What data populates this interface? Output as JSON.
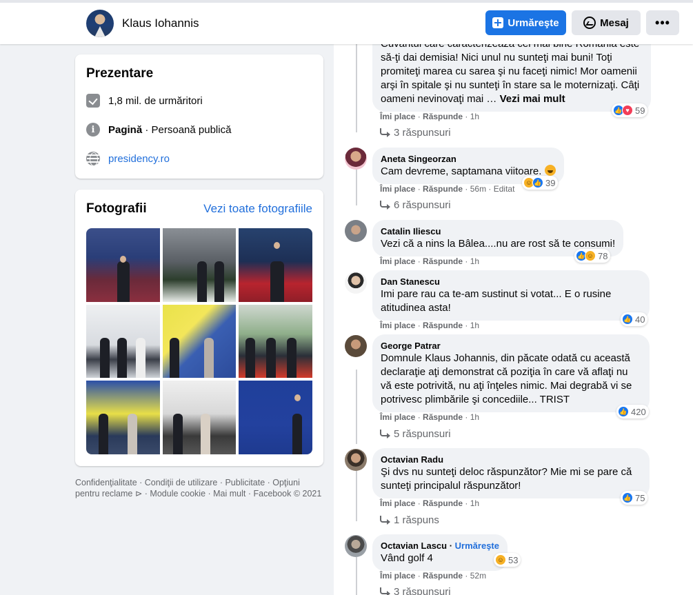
{
  "header": {
    "name": "Klaus Iohannis",
    "follow_label": "Urmăreşte",
    "message_label": "Mesaj",
    "more_label": "•••"
  },
  "intro": {
    "title": "Prezentare",
    "followers": "1,8 mil. de urmăritori",
    "page_type_bold": "Pagină",
    "page_type_rest": " · Persoană publică",
    "website": "presidency.ro"
  },
  "photos": {
    "title": "Fotografii",
    "see_all": "Vezi toate fotografiile"
  },
  "footer": {
    "text": "Confidenţialitate · Condiţii de utilizare · Publicitate · Opţiuni pentru reclame ⊳ · Module cookie · Mai mult · Facebook © 2021"
  },
  "comments": [
    {
      "text": "Cuvântul care caracterizează cel mai bine România este să-ţi dai demisia! Nici unul nu sunteţi mai buni! Toţi promiteţi marea cu sarea şi nu faceţi nimic! Mor oamenii arşi în spitale şi nu sunteţi în stare sa le moternizaţi. Câţi oameni nevinovaţi mai …",
      "see_more": "Vezi mai mult",
      "like": "Îmi place",
      "reply": "Răspunde",
      "time": "1h",
      "reactions": "59",
      "replies": "3 răspunsuri"
    },
    {
      "author": "Aneta Singeorzan",
      "text": "Cam devreme, saptamana viitoare.",
      "like": "Îmi place",
      "reply": "Răspunde",
      "time": "56m",
      "edited": "Editat",
      "reactions": "39",
      "replies": "6 răspunsuri"
    },
    {
      "author": "Catalin Iliescu",
      "text": "Vezi că a nins la Bâlea....nu are rost să te consumi!",
      "like": "Îmi place",
      "reply": "Răspunde",
      "time": "1h",
      "reactions": "78"
    },
    {
      "author": "Dan Stanescu",
      "text": "Imi pare rau ca te-am sustinut si votat... E o rusine atitudinea asta!",
      "like": "Îmi place",
      "reply": "Răspunde",
      "time": "1h",
      "reactions": "40"
    },
    {
      "author": "George Patrar",
      "text": "Domnule Klaus Johannis, din păcate odată cu această declaraţie aţi demonstrat că poziţia în care vă aflaţi nu vă este potrivită, nu aţi înţeles nimic. Mai degrabă vi se potrivesc plimbările şi concediile... TRIST",
      "like": "Îmi place",
      "reply": "Răspunde",
      "time": "1h",
      "reactions": "420",
      "replies": "5 răspunsuri"
    },
    {
      "author": "Octavian Radu",
      "text": "Şi dvs nu sunteţi deloc răspunzător? Mie mi se pare că sunteţi principalul răspunzător!",
      "like": "Îmi place",
      "reply": "Răspunde",
      "time": "1h",
      "reactions": "75",
      "replies": "1 răspuns"
    },
    {
      "author": "Octavian Lascu",
      "follow": "Urmăreşte",
      "text": "Vând golf 4",
      "like": "Îmi place",
      "reply": "Răspunde",
      "time": "52m",
      "reactions": "53",
      "replies": "3 răspunsuri"
    }
  ],
  "colors": {
    "accent": "#1b74e4",
    "link": "#216fdb",
    "background": "#f0f2f5"
  }
}
